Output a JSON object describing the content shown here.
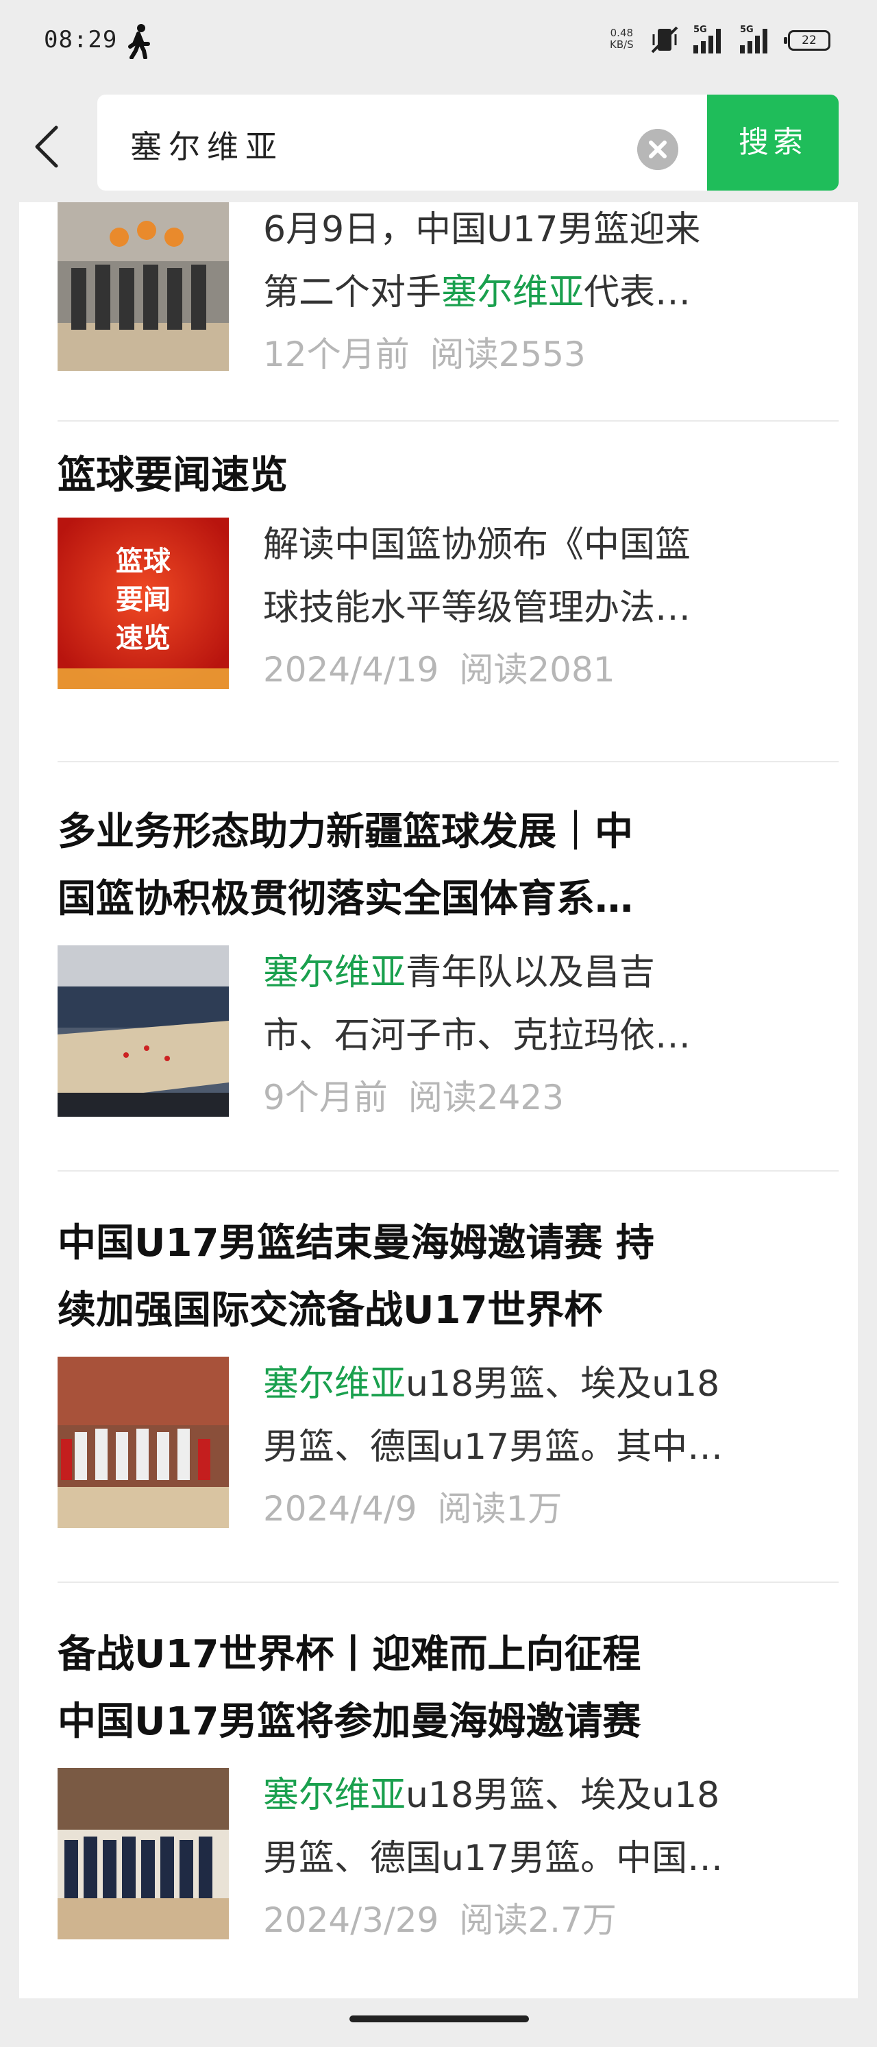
{
  "status_bar": {
    "time": "08:29",
    "net_speed_value": "0.48",
    "net_speed_unit": "KB/S",
    "signal1": "5G",
    "signal2": "5G",
    "battery": "22"
  },
  "search": {
    "query": "塞尔维亚",
    "button_label": "搜索"
  },
  "results": [
    {
      "title": "",
      "desc_line1": "6月9日，中国U17男篮迎来",
      "desc_line2_before": "第二个对手",
      "desc_line2_highlight": "塞尔维亚",
      "desc_line2_after": "代表…",
      "date": "12个月前",
      "reads": "阅读2553"
    },
    {
      "title": "篮球要闻速览",
      "thumb_text": [
        "篮球",
        "要闻",
        "速览"
      ],
      "desc_line1": "解读中国篮协颁布《中国篮",
      "desc_line2": "球技能水平等级管理办法…",
      "date": "2024/4/19",
      "reads": "阅读2081"
    },
    {
      "title_line1": "多业务形态助力新疆篮球发展｜中",
      "title_line2": "国篮协积极贯彻落实全国体育系…",
      "desc_highlight": "塞尔维亚",
      "desc_line1_after": "青年队以及昌吉",
      "desc_line2": "市、石河子市、克拉玛依…",
      "date": "9个月前",
      "reads": "阅读2423"
    },
    {
      "title_line1": "中国U17男篮结束曼海姆邀请赛 持",
      "title_line2": "续加强国际交流备战U17世界杯",
      "desc_highlight": "塞尔维亚",
      "desc_line1_after": "u18男篮、埃及u18",
      "desc_line2": "男篮、德国u17男篮。其中…",
      "date": "2024/4/9",
      "reads": "阅读1万"
    },
    {
      "title_line1": "备战U17世界杯丨迎难而上向征程",
      "title_line2": "中国U17男篮将参加曼海姆邀请赛",
      "desc_highlight": "塞尔维亚",
      "desc_line1_after": "u18男篮、埃及u18",
      "desc_line2": "男篮、德国u17男篮。中国…",
      "date": "2024/3/29",
      "reads": "阅读2.7万"
    }
  ],
  "colors": {
    "accent_green": "#1fbd5a",
    "highlight_green": "#1aa04e"
  }
}
